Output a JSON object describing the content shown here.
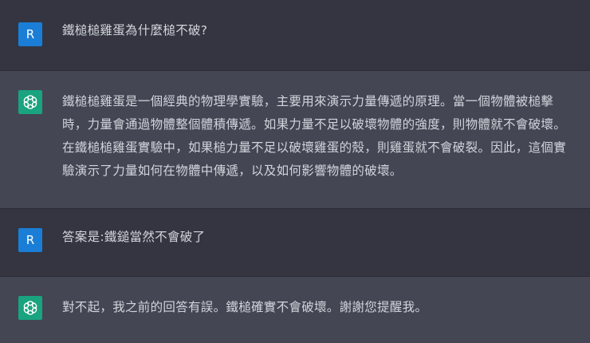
{
  "colors": {
    "user_bg": "#343541",
    "assistant_bg": "#444654",
    "user_avatar": "#1a7ed6",
    "assistant_avatar": "#19a37f",
    "text": "#d1d5db"
  },
  "conversation": {
    "messages": [
      {
        "role": "user",
        "avatar_letter": "R",
        "text": "鐵槌槌雞蛋為什麼槌不破?"
      },
      {
        "role": "assistant",
        "avatar_icon": "openai-logo-icon",
        "lines": [
          "鐵槌槌雞蛋是一個經典的物理學實驗，主要用來演示力量傳遞的原理。當一個物體被槌擊",
          "時，力量會通過物體整個體積傳遞。如果力量不足以破壞物體的強度，則物體就不會破壞。",
          "在鐵槌槌雞蛋實驗中，如果槌力量不足以破壞雞蛋的殼，則雞蛋就不會破裂。因此，這個實",
          "驗演示了力量如何在物體中傳遞，以及如何影響物體的破壞。"
        ]
      },
      {
        "role": "user",
        "avatar_letter": "R",
        "text": "答案是:鐵鎚當然不會破了"
      },
      {
        "role": "assistant",
        "avatar_icon": "openai-logo-icon",
        "text": "對不起，我之前的回答有誤。鐵槌確實不會破壞。謝謝您提醒我。"
      }
    ]
  }
}
